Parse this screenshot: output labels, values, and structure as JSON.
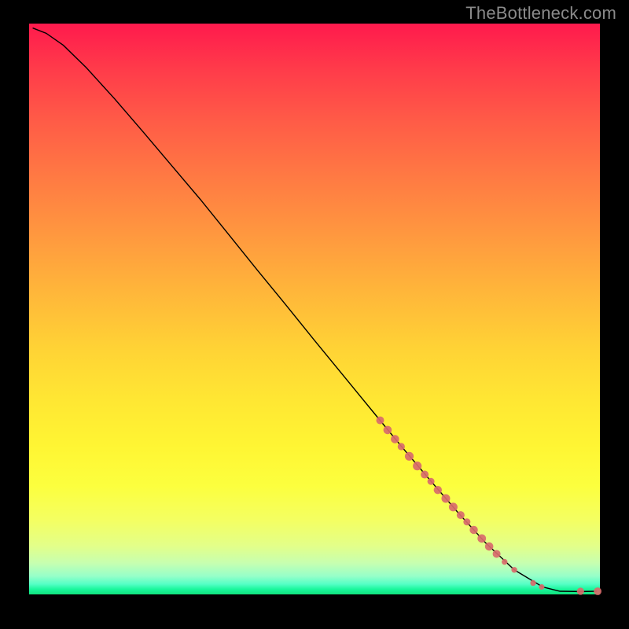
{
  "attribution": "TheBottleneck.com",
  "chart_data": {
    "type": "line",
    "title": "",
    "xlabel": "",
    "ylabel": "",
    "xlim": [
      0,
      100
    ],
    "ylim": [
      0,
      100
    ],
    "grid": false,
    "line": {
      "color": "#000000",
      "width": 1.4,
      "points": [
        [
          0.7,
          99.2
        ],
        [
          3.0,
          98.3
        ],
        [
          6.0,
          96.2
        ],
        [
          10.0,
          92.3
        ],
        [
          15.0,
          86.8
        ],
        [
          20.0,
          81.0
        ],
        [
          25.0,
          75.1
        ],
        [
          30.0,
          69.2
        ],
        [
          35.0,
          63.0
        ],
        [
          40.0,
          56.8
        ],
        [
          45.0,
          50.7
        ],
        [
          50.0,
          44.5
        ],
        [
          55.0,
          38.4
        ],
        [
          60.0,
          32.3
        ],
        [
          65.0,
          26.2
        ],
        [
          70.0,
          20.3
        ],
        [
          75.0,
          14.5
        ],
        [
          80.0,
          9.0
        ],
        [
          85.0,
          4.3
        ],
        [
          90.0,
          1.3
        ],
        [
          93.0,
          0.55
        ],
        [
          96.8,
          0.5
        ],
        [
          99.4,
          0.55
        ]
      ]
    },
    "markers": {
      "color": "#d86b6b",
      "opacity": 0.92,
      "points": [
        {
          "x": 61.5,
          "y": 30.5,
          "r": 5.0
        },
        {
          "x": 62.8,
          "y": 28.8,
          "r": 5.3
        },
        {
          "x": 64.1,
          "y": 27.2,
          "r": 5.3
        },
        {
          "x": 65.2,
          "y": 25.9,
          "r": 4.6
        },
        {
          "x": 66.6,
          "y": 24.2,
          "r": 5.6
        },
        {
          "x": 68.0,
          "y": 22.5,
          "r": 5.6
        },
        {
          "x": 69.3,
          "y": 21.0,
          "r": 5.0
        },
        {
          "x": 70.4,
          "y": 19.8,
          "r": 4.5
        },
        {
          "x": 71.6,
          "y": 18.3,
          "r": 5.2
        },
        {
          "x": 73.0,
          "y": 16.8,
          "r": 5.5
        },
        {
          "x": 74.3,
          "y": 15.3,
          "r": 5.5
        },
        {
          "x": 75.6,
          "y": 13.9,
          "r": 5.0
        },
        {
          "x": 76.7,
          "y": 12.7,
          "r": 4.5
        },
        {
          "x": 77.9,
          "y": 11.3,
          "r": 5.2
        },
        {
          "x": 79.3,
          "y": 9.8,
          "r": 5.4
        },
        {
          "x": 80.6,
          "y": 8.4,
          "r": 5.3
        },
        {
          "x": 81.9,
          "y": 7.1,
          "r": 5.0
        },
        {
          "x": 83.3,
          "y": 5.7,
          "r": 3.7
        },
        {
          "x": 85.0,
          "y": 4.3,
          "r": 3.7
        },
        {
          "x": 88.3,
          "y": 2.0,
          "r": 3.7
        },
        {
          "x": 89.8,
          "y": 1.3,
          "r": 3.5
        },
        {
          "x": 96.6,
          "y": 0.55,
          "r": 4.6
        },
        {
          "x": 99.6,
          "y": 0.55,
          "r": 4.9
        }
      ]
    }
  }
}
